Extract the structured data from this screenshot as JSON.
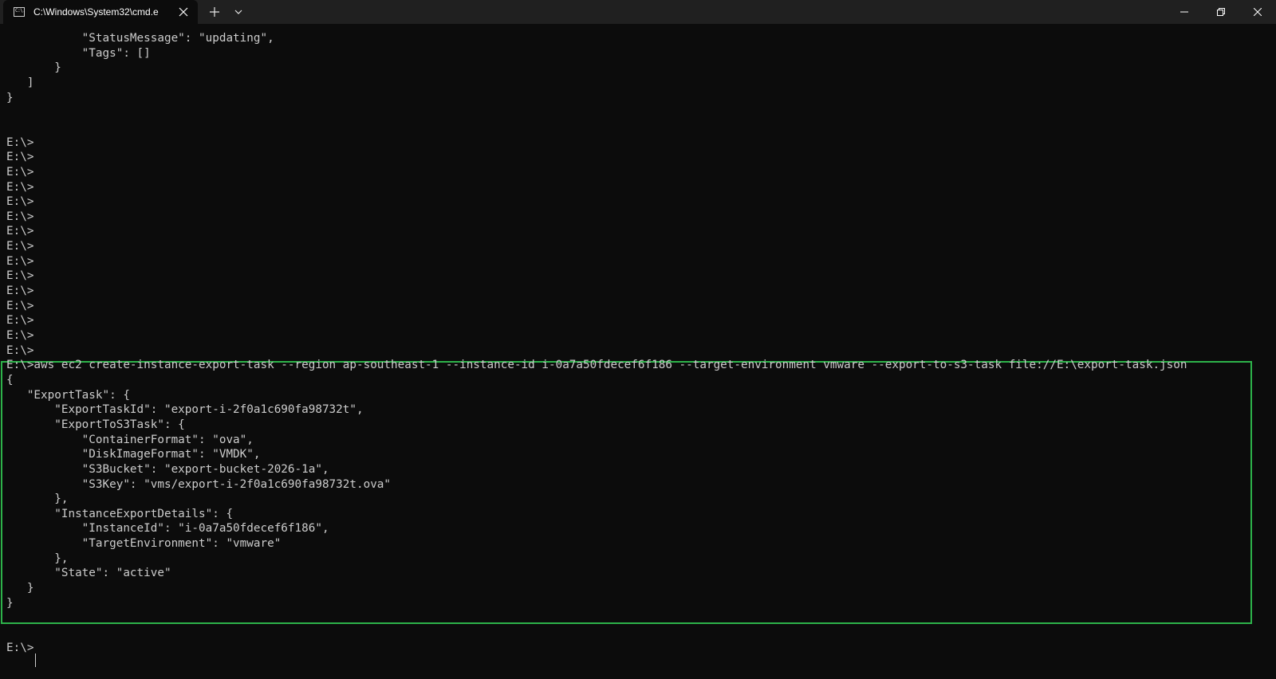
{
  "window": {
    "tab_title": "C:\\Windows\\System32\\cmd.e",
    "icon": "cmd-icon",
    "icon_text": "C:\\.",
    "highlight_color": "#2db34a"
  },
  "terminal": {
    "lines": [
      "           \"StatusMessage\": \"updating\",",
      "           \"Tags\": []",
      "       }",
      "   ]",
      "}",
      "",
      "",
      "E:\\>",
      "E:\\>",
      "E:\\>",
      "E:\\>",
      "E:\\>",
      "E:\\>",
      "E:\\>",
      "E:\\>",
      "E:\\>",
      "E:\\>",
      "E:\\>",
      "E:\\>",
      "E:\\>",
      "E:\\>",
      "E:\\>",
      "E:\\>aws ec2 create-instance-export-task --region ap-southeast-1 --instance-id i-0a7a50fdecef6f186 --target-environment vmware --export-to-s3-task file://E:\\export-task.json",
      "{",
      "   \"ExportTask\": {",
      "       \"ExportTaskId\": \"export-i-2f0a1c690fa98732t\",",
      "       \"ExportToS3Task\": {",
      "           \"ContainerFormat\": \"ova\",",
      "           \"DiskImageFormat\": \"VMDK\",",
      "           \"S3Bucket\": \"export-bucket-2026-1a\",",
      "           \"S3Key\": \"vms/export-i-2f0a1c690fa98732t.ova\"",
      "       },",
      "       \"InstanceExportDetails\": {",
      "           \"InstanceId\": \"i-0a7a50fdecef6f186\",",
      "           \"TargetEnvironment\": \"vmware\"",
      "       },",
      "       \"State\": \"active\"",
      "   }",
      "}",
      "",
      "",
      "E:\\>"
    ]
  }
}
